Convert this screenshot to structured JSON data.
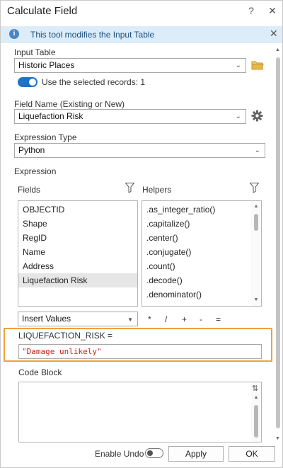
{
  "window": {
    "title": "Calculate Field",
    "help_label": "?",
    "close_label": "✕"
  },
  "info_bar": {
    "text": "This tool modifies the Input Table",
    "icon_glyph": "i",
    "close_label": "✕"
  },
  "input_table": {
    "label": "Input Table",
    "value": "Historic Places",
    "use_selected_label": "Use the selected records: 1",
    "use_selected_on": true
  },
  "field_name": {
    "label": "Field Name (Existing or New)",
    "value": "Liquefaction Risk"
  },
  "expression_type": {
    "label": "Expression Type",
    "value": "Python"
  },
  "expression": {
    "label": "Expression",
    "fields_label": "Fields",
    "helpers_label": "Helpers",
    "fields": [
      "OBJECTID",
      "Shape",
      "RegID",
      "Name",
      "Address",
      "Liquefaction Risk"
    ],
    "selected_field": "Liquefaction Risk",
    "helpers": [
      ".as_integer_ratio()",
      ".capitalize()",
      ".center()",
      ".conjugate()",
      ".count()",
      ".decode()",
      ".denominator()"
    ],
    "insert_values_label": "Insert Values",
    "operators": [
      "*",
      "/",
      "+",
      "-",
      "="
    ],
    "assignment_label": "LIQUEFACTION_RISK =",
    "value": "\"Damage unlikely\""
  },
  "code_block": {
    "label": "Code Block",
    "scroll_icon_glyph": "⇅"
  },
  "footer": {
    "enable_undo_label": "Enable Undo",
    "enable_undo_on": false,
    "apply_label": "Apply",
    "ok_label": "OK"
  },
  "colors": {
    "accent": "#1f72c6",
    "highlight_frame": "#f0a040",
    "expression_text": "#c8201e",
    "info_bar_bg": "#dcecf8",
    "folder_icon": "#e8b64a"
  }
}
